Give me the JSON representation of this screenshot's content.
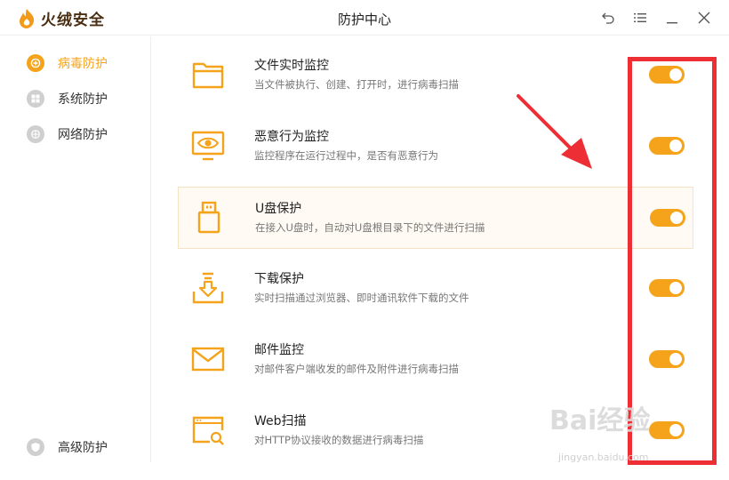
{
  "app": {
    "name": "火绒安全",
    "window_title": "防护中心"
  },
  "window_controls": [
    "back-icon",
    "menu-icon",
    "minimize-icon",
    "close-icon"
  ],
  "sidebar": {
    "items": [
      {
        "label": "病毒防护",
        "icon": "virus-protect-icon",
        "active": true
      },
      {
        "label": "系统防护",
        "icon": "windows-icon",
        "active": false
      },
      {
        "label": "网络防护",
        "icon": "network-icon",
        "active": false
      }
    ],
    "bottom_item": {
      "label": "高级防护",
      "icon": "shield-icon"
    }
  },
  "main": {
    "rows": [
      {
        "title": "文件实时监控",
        "desc": "当文件被执行、创建、打开时，进行病毒扫描",
        "icon": "folder-icon",
        "enabled": true
      },
      {
        "title": "恶意行为监控",
        "desc": "监控程序在运行过程中，是否有恶意行为",
        "icon": "monitor-eye-icon",
        "enabled": true
      },
      {
        "title": "U盘保护",
        "desc": "在接入U盘时，自动对U盘根目录下的文件进行扫描",
        "icon": "usb-icon",
        "enabled": true
      },
      {
        "title": "下载保护",
        "desc": "实时扫描通过浏览器、即时通讯软件下载的文件",
        "icon": "download-tray-icon",
        "enabled": true
      },
      {
        "title": "邮件监控",
        "desc": "对邮件客户端收发的邮件及附件进行病毒扫描",
        "icon": "mail-icon",
        "enabled": true
      },
      {
        "title": "Web扫描",
        "desc": "对HTTP协议接收的数据进行病毒扫描",
        "icon": "web-scan-icon",
        "enabled": true
      }
    ]
  },
  "watermark": {
    "text": "Bai经验",
    "sub": "jingyan.baidu.com"
  },
  "colors": {
    "accent": "#f5a31a",
    "annotation": "#ee2e35",
    "title_text": "#4a2e12"
  }
}
